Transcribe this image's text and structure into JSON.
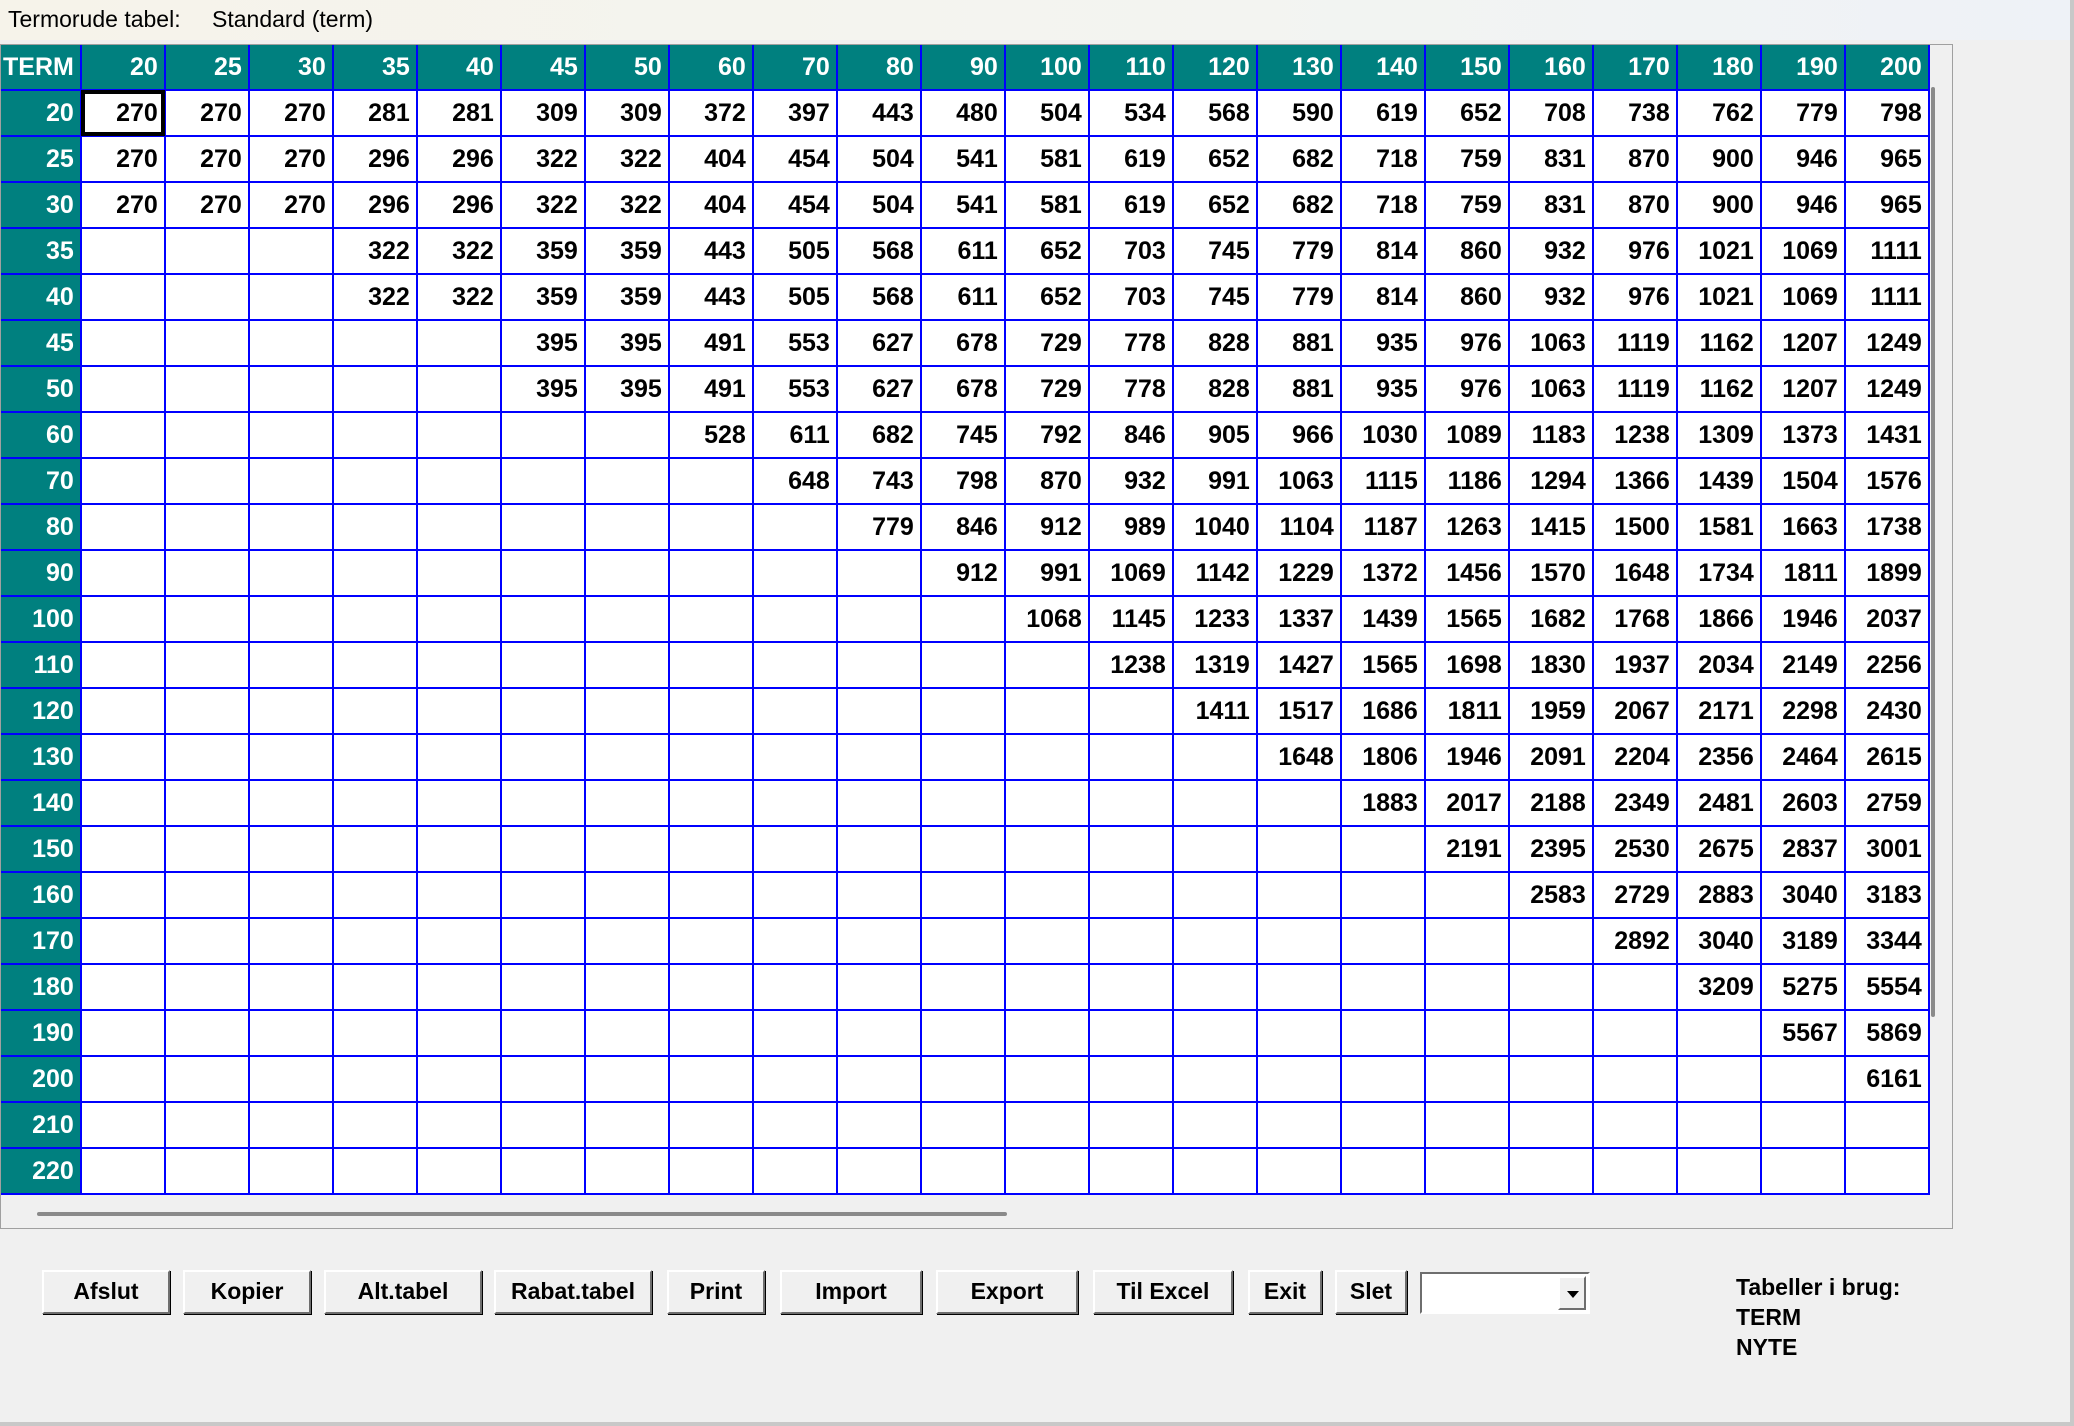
{
  "header": {
    "label": "Termorude tabel:",
    "value": "Standard (term)"
  },
  "grid": {
    "corner": "TERM",
    "columns": [
      "20",
      "25",
      "30",
      "35",
      "40",
      "45",
      "50",
      "60",
      "70",
      "80",
      "90",
      "100",
      "110",
      "120",
      "130",
      "140",
      "150",
      "160",
      "170",
      "180",
      "190",
      "200"
    ],
    "rows": [
      {
        "label": "20",
        "cells": [
          "270",
          "270",
          "270",
          "281",
          "281",
          "309",
          "309",
          "372",
          "397",
          "443",
          "480",
          "504",
          "534",
          "568",
          "590",
          "619",
          "652",
          "708",
          "738",
          "762",
          "779",
          "798"
        ]
      },
      {
        "label": "25",
        "cells": [
          "270",
          "270",
          "270",
          "296",
          "296",
          "322",
          "322",
          "404",
          "454",
          "504",
          "541",
          "581",
          "619",
          "652",
          "682",
          "718",
          "759",
          "831",
          "870",
          "900",
          "946",
          "965"
        ]
      },
      {
        "label": "30",
        "cells": [
          "270",
          "270",
          "270",
          "296",
          "296",
          "322",
          "322",
          "404",
          "454",
          "504",
          "541",
          "581",
          "619",
          "652",
          "682",
          "718",
          "759",
          "831",
          "870",
          "900",
          "946",
          "965"
        ]
      },
      {
        "label": "35",
        "cells": [
          "",
          "",
          "",
          "322",
          "322",
          "359",
          "359",
          "443",
          "505",
          "568",
          "611",
          "652",
          "703",
          "745",
          "779",
          "814",
          "860",
          "932",
          "976",
          "1021",
          "1069",
          "1111"
        ]
      },
      {
        "label": "40",
        "cells": [
          "",
          "",
          "",
          "322",
          "322",
          "359",
          "359",
          "443",
          "505",
          "568",
          "611",
          "652",
          "703",
          "745",
          "779",
          "814",
          "860",
          "932",
          "976",
          "1021",
          "1069",
          "1111"
        ]
      },
      {
        "label": "45",
        "cells": [
          "",
          "",
          "",
          "",
          "",
          "395",
          "395",
          "491",
          "553",
          "627",
          "678",
          "729",
          "778",
          "828",
          "881",
          "935",
          "976",
          "1063",
          "1119",
          "1162",
          "1207",
          "1249"
        ]
      },
      {
        "label": "50",
        "cells": [
          "",
          "",
          "",
          "",
          "",
          "395",
          "395",
          "491",
          "553",
          "627",
          "678",
          "729",
          "778",
          "828",
          "881",
          "935",
          "976",
          "1063",
          "1119",
          "1162",
          "1207",
          "1249"
        ]
      },
      {
        "label": "60",
        "cells": [
          "",
          "",
          "",
          "",
          "",
          "",
          "",
          "528",
          "611",
          "682",
          "745",
          "792",
          "846",
          "905",
          "966",
          "1030",
          "1089",
          "1183",
          "1238",
          "1309",
          "1373",
          "1431"
        ]
      },
      {
        "label": "70",
        "cells": [
          "",
          "",
          "",
          "",
          "",
          "",
          "",
          "",
          "648",
          "743",
          "798",
          "870",
          "932",
          "991",
          "1063",
          "1115",
          "1186",
          "1294",
          "1366",
          "1439",
          "1504",
          "1576"
        ]
      },
      {
        "label": "80",
        "cells": [
          "",
          "",
          "",
          "",
          "",
          "",
          "",
          "",
          "",
          "779",
          "846",
          "912",
          "989",
          "1040",
          "1104",
          "1187",
          "1263",
          "1415",
          "1500",
          "1581",
          "1663",
          "1738"
        ]
      },
      {
        "label": "90",
        "cells": [
          "",
          "",
          "",
          "",
          "",
          "",
          "",
          "",
          "",
          "",
          "912",
          "991",
          "1069",
          "1142",
          "1229",
          "1372",
          "1456",
          "1570",
          "1648",
          "1734",
          "1811",
          "1899"
        ]
      },
      {
        "label": "100",
        "cells": [
          "",
          "",
          "",
          "",
          "",
          "",
          "",
          "",
          "",
          "",
          "",
          "1068",
          "1145",
          "1233",
          "1337",
          "1439",
          "1565",
          "1682",
          "1768",
          "1866",
          "1946",
          "2037"
        ]
      },
      {
        "label": "110",
        "cells": [
          "",
          "",
          "",
          "",
          "",
          "",
          "",
          "",
          "",
          "",
          "",
          "",
          "1238",
          "1319",
          "1427",
          "1565",
          "1698",
          "1830",
          "1937",
          "2034",
          "2149",
          "2256"
        ]
      },
      {
        "label": "120",
        "cells": [
          "",
          "",
          "",
          "",
          "",
          "",
          "",
          "",
          "",
          "",
          "",
          "",
          "",
          "1411",
          "1517",
          "1686",
          "1811",
          "1959",
          "2067",
          "2171",
          "2298",
          "2430"
        ]
      },
      {
        "label": "130",
        "cells": [
          "",
          "",
          "",
          "",
          "",
          "",
          "",
          "",
          "",
          "",
          "",
          "",
          "",
          "",
          "1648",
          "1806",
          "1946",
          "2091",
          "2204",
          "2356",
          "2464",
          "2615"
        ]
      },
      {
        "label": "140",
        "cells": [
          "",
          "",
          "",
          "",
          "",
          "",
          "",
          "",
          "",
          "",
          "",
          "",
          "",
          "",
          "",
          "1883",
          "2017",
          "2188",
          "2349",
          "2481",
          "2603",
          "2759"
        ]
      },
      {
        "label": "150",
        "cells": [
          "",
          "",
          "",
          "",
          "",
          "",
          "",
          "",
          "",
          "",
          "",
          "",
          "",
          "",
          "",
          "",
          "2191",
          "2395",
          "2530",
          "2675",
          "2837",
          "3001"
        ]
      },
      {
        "label": "160",
        "cells": [
          "",
          "",
          "",
          "",
          "",
          "",
          "",
          "",
          "",
          "",
          "",
          "",
          "",
          "",
          "",
          "",
          "",
          "2583",
          "2729",
          "2883",
          "3040",
          "3183"
        ]
      },
      {
        "label": "170",
        "cells": [
          "",
          "",
          "",
          "",
          "",
          "",
          "",
          "",
          "",
          "",
          "",
          "",
          "",
          "",
          "",
          "",
          "",
          "",
          "2892",
          "3040",
          "3189",
          "3344"
        ]
      },
      {
        "label": "180",
        "cells": [
          "",
          "",
          "",
          "",
          "",
          "",
          "",
          "",
          "",
          "",
          "",
          "",
          "",
          "",
          "",
          "",
          "",
          "",
          "",
          "3209",
          "5275",
          "5554"
        ]
      },
      {
        "label": "190",
        "cells": [
          "",
          "",
          "",
          "",
          "",
          "",
          "",
          "",
          "",
          "",
          "",
          "",
          "",
          "",
          "",
          "",
          "",
          "",
          "",
          "",
          "5567",
          "5869"
        ]
      },
      {
        "label": "200",
        "cells": [
          "",
          "",
          "",
          "",
          "",
          "",
          "",
          "",
          "",
          "",
          "",
          "",
          "",
          "",
          "",
          "",
          "",
          "",
          "",
          "",
          "",
          "6161"
        ]
      },
      {
        "label": "210",
        "cells": [
          "",
          "",
          "",
          "",
          "",
          "",
          "",
          "",
          "",
          "",
          "",
          "",
          "",
          "",
          "",
          "",
          "",
          "",
          "",
          "",
          "",
          ""
        ]
      },
      {
        "label": "220",
        "cells": [
          "",
          "",
          "",
          "",
          "",
          "",
          "",
          "",
          "",
          "",
          "",
          "",
          "",
          "",
          "",
          "",
          "",
          "",
          "",
          "",
          "",
          ""
        ]
      }
    ]
  },
  "buttons": {
    "afslut": "Afslut",
    "kopier": "Kopier",
    "alt_tabel": "Alt.tabel",
    "rabat_tabel": "Rabat.tabel",
    "print": "Print",
    "import": "Import",
    "export": "Export",
    "til_excel": "Til Excel",
    "exit": "Exit",
    "slet": "Slet"
  },
  "dropdown": {
    "value": ""
  },
  "tables_in_use": {
    "title": "Tabeller i brug:",
    "items": [
      "TERM",
      "NYTE"
    ]
  }
}
